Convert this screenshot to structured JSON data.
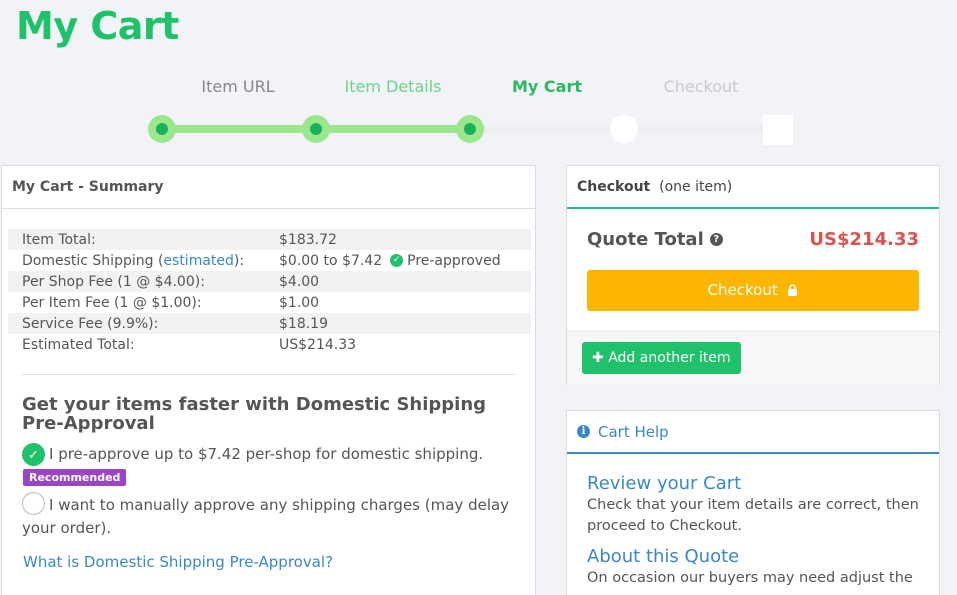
{
  "page": {
    "title": "My Cart"
  },
  "steps": [
    {
      "label": "Item URL",
      "state": "past"
    },
    {
      "label": "Item Details",
      "state": "done"
    },
    {
      "label": "My Cart",
      "state": "current"
    },
    {
      "label": "Checkout",
      "state": "future"
    }
  ],
  "summary": {
    "header": "My Cart - Summary",
    "rows": [
      {
        "label": "Item Total:",
        "value": "$183.72"
      },
      {
        "label_prefix": "Domestic Shipping  (",
        "label_link": "estimated",
        "label_suffix": "):",
        "value": "$0.00 to $7.42",
        "status": "Pre-approved"
      },
      {
        "label": "Per Shop Fee (1 @ $4.00):",
        "value": "$4.00"
      },
      {
        "label": "Per Item Fee (1 @ $1.00):",
        "value": "$1.00"
      },
      {
        "label": "Service Fee (9.9%):",
        "value": "$18.19"
      },
      {
        "label": "Estimated Total:",
        "value": "US$214.33"
      }
    ],
    "promo_title": "Get your items faster with Domestic Shipping Pre-Approval",
    "option_preapprove": "I pre-approve up to $7.42 per-shop for domestic shipping.",
    "badge": "Recommended",
    "option_manual": "I want to manually approve any shipping charges (may delay your order).",
    "what_link": "What is Domestic Shipping Pre-Approval?"
  },
  "checkout": {
    "header_bold": "Checkout",
    "header_note": "(one item)",
    "quote_label": "Quote Total",
    "quote_total": "US$214.33",
    "checkout_button": "Checkout",
    "add_button": "Add another item"
  },
  "help": {
    "header": "Cart Help",
    "sections": [
      {
        "title": "Review your Cart",
        "body": "Check that your item details are correct, then proceed to Checkout."
      },
      {
        "title": "About this Quote",
        "body": "On occasion our buyers may need adjust the"
      }
    ]
  },
  "colors": {
    "brand_green": "#1fc16b",
    "checkout_orange": "#fcb600",
    "total_red": "#d9534f",
    "link_blue": "#3a87c8",
    "badge_purple": "#9a45c6"
  }
}
